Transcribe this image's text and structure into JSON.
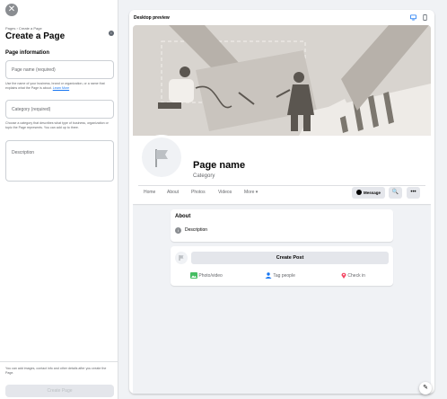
{
  "sidebar": {
    "close_glyph": "✕",
    "breadcrumb": "Pages › Create a Page",
    "title": "Create a Page",
    "info_glyph": "i",
    "section_title": "Page information",
    "page_name_placeholder": "Page name (required)",
    "page_name_help": "Use the name of your business, brand or organization, or a name that explains what the Page is about.",
    "learn_more": "Learn More",
    "category_placeholder": "Category (required)",
    "category_help": "Choose a category that describes what type of business, organization or topic the Page represents. You can add up to three.",
    "description_placeholder": "Description",
    "bottom_note": "You can add images, contact info and other details after you create the Page.",
    "create_button": "Create Page"
  },
  "preview": {
    "title": "Desktop preview",
    "page_name": "Page name",
    "category": "Category",
    "tabs": [
      "Home",
      "About",
      "Photos",
      "Videos",
      "More ▾"
    ],
    "message_button": "Message",
    "search_glyph": "🔍",
    "more_glyph": "•••",
    "about_title": "About",
    "info_glyph": "i",
    "about_description": "Description",
    "create_post": "Create Post",
    "actions": [
      "Photo/video",
      "Tag people",
      "Check in"
    ],
    "edit_glyph": "✎"
  },
  "colors": {
    "accent": "#1877f2",
    "photo_green": "#45bd62",
    "tag_blue": "#1877f2",
    "checkin_red": "#f3425f"
  }
}
